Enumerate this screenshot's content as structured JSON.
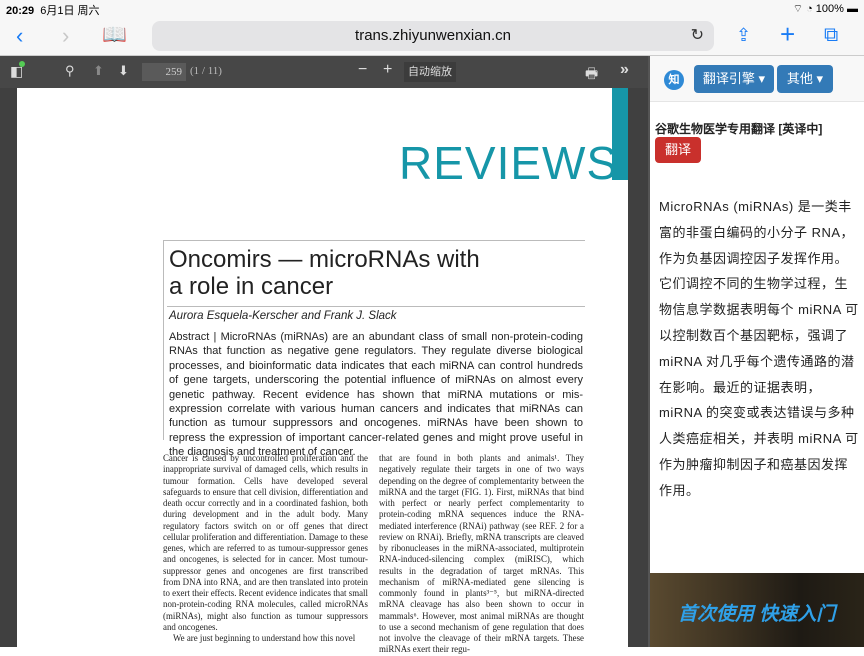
{
  "status": {
    "time": "20:29",
    "date": "6月1日 周六",
    "battery": "100%"
  },
  "browser": {
    "url": "trans.zhiyunwenxian.cn"
  },
  "pdf_toolbar": {
    "page_number": "259",
    "page_count": "(1 / 11)",
    "zoom": "自动缩放"
  },
  "document": {
    "section": "REVIEWS",
    "title_line1": "Oncomirs — microRNAs with",
    "title_line2": "a role in cancer",
    "authors": "Aurora Esquela-Kerscher and Frank J. Slack",
    "abstract": "Abstract | MicroRNAs (miRNAs) are an abundant class of small non-protein-coding RNAs that function as negative gene regulators. They regulate diverse biological processes, and bioinformatic data indicates that each miRNA can control hundreds of gene targets, underscoring the potential influence of miRNAs on almost every genetic pathway. Recent evidence has shown that miRNA mutations or mis-expression correlate with various human cancers and indicates that miRNAs can function as tumour suppressors and oncogenes. miRNAs have been shown to repress the expression of important cancer-related genes and might prove useful in the diagnosis and treatment of cancer.",
    "col1": "Cancer is caused by uncontrolled proliferation and the inappropriate survival of damaged cells, which results in tumour formation. Cells have developed several safeguards to ensure that cell division, differentiation and death occur correctly and in a coordinated fashion, both during development and in the adult body. Many regulatory factors switch on or off genes that direct cellular proliferation and differentiation. Damage to these genes, which are referred to as tumour-suppressor genes and oncogenes, is selected for in cancer. Most tumour-suppressor genes and oncogenes are first transcribed from DNA into RNA, and are then translated into protein to exert their effects. Recent evidence indicates that small non-protein-coding RNA molecules, called microRNAs (miRNAs), might also function as tumour suppressors and oncogenes.",
    "col1_p2": "We are just beginning to understand how this novel",
    "col2": "that are found in both plants and animals¹. They negatively regulate their targets in one of two ways depending on the degree of complementarity between the miRNA and the target (FIG. 1). First, miRNAs that bind with perfect or nearly perfect complementarity to protein-coding mRNA sequences induce the RNA-mediated interference (RNAi) pathway (see REF. 2 for a review on RNAi). Briefly, mRNA transcripts are cleaved by ribonucleases in the miRNA-associated, multiprotein RNA-induced-silencing complex (miRISC), which results in the degradation of target mRNAs. This mechanism of miRNA-mediated gene silencing is commonly found in plants³⁻⁵, but miRNA-directed mRNA cleavage has also been shown to occur in mammals⁶. However, most animal miRNAs are thought to use a second mechanism of gene regulation that does not involve the cleavage of their mRNA targets. These miRNAs exert their regu-"
  },
  "panel": {
    "logo": "知",
    "engine_btn": "翻译引擎 ▾",
    "other_btn": "其他 ▾",
    "service": "谷歌生物医学专用翻译 [英译中]",
    "translate_btn": "翻译",
    "result": "MicroRNAs (miRNAs) 是一类丰富的非蛋白编码的小分子 RNA，作为负基因调控因子发挥作用。它们调控不同的生物学过程，生物信息学数据表明每个 miRNA 可以控制数百个基因靶标，强调了 miRNA 对几乎每个遗传通路的潜在影响。最近的证据表明，miRNA 的突变或表达错误与多种人类癌症相关，并表明 miRNA 可作为肿瘤抑制因子和癌基因发挥作用。",
    "banner": "首次使用 快速入门"
  }
}
